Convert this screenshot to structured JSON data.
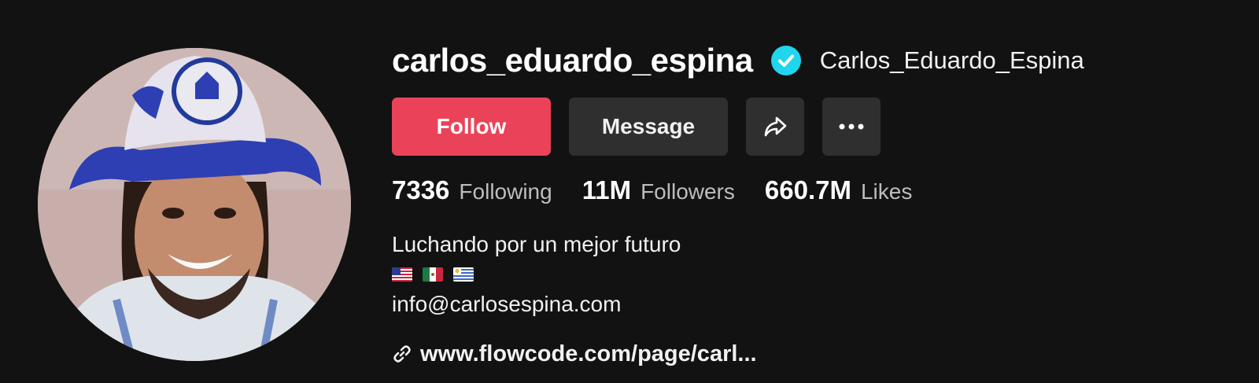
{
  "profile": {
    "username": "carlos_eduardo_espina",
    "nickname": "Carlos_Eduardo_Espina",
    "verified": true,
    "avatar": "profile-photo"
  },
  "actions": {
    "follow_label": "Follow",
    "message_label": "Message",
    "share_icon": "share-arrow-icon",
    "more_icon": "more-dots-icon"
  },
  "stats": {
    "following": {
      "value": "7336",
      "label": "Following"
    },
    "followers": {
      "value": "11M",
      "label": "Followers"
    },
    "likes": {
      "value": "660.7M",
      "label": "Likes"
    }
  },
  "bio": {
    "line1": "Luchando por un mejor futuro",
    "flags": [
      "us-flag",
      "mexico-flag",
      "uruguay-flag"
    ],
    "email": "info@carlosespina.com"
  },
  "link": {
    "icon": "link-icon",
    "text": "www.flowcode.com/page/carl..."
  },
  "colors": {
    "background": "#121212",
    "follow_button": "#ea4359",
    "secondary_button": "#2f2f2f",
    "verified_badge": "#20d5ec"
  }
}
